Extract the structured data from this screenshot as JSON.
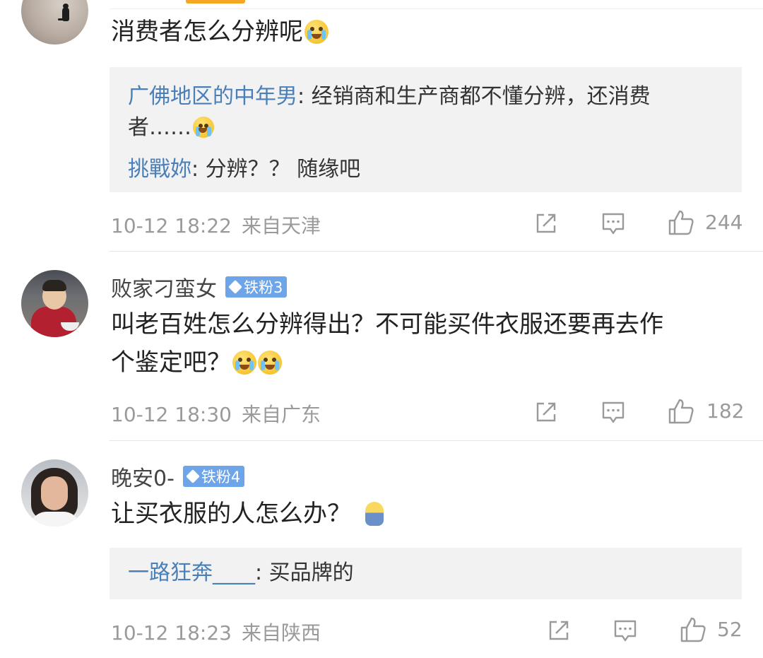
{
  "comments": [
    {
      "username": "",
      "badge": "",
      "text": "消费者怎么分辨呢",
      "emojis": [
        "crying-face"
      ],
      "replies": [
        {
          "name": "广佛地区的中年男",
          "text_line1": ": 经销商和生产商都不懂分辨，还消费",
          "text_line2": "者……"
        },
        {
          "name": "挑戰妳",
          "text": ": 分辨？？ 随缘吧"
        }
      ],
      "time": "10-12 18:22",
      "location": "来自天津",
      "likes": "244"
    },
    {
      "username": "败家刁蛮女",
      "badge": "铁粉3",
      "text_line1": "叫老百姓怎么分辨得出？不可能买件衣服还要再去作",
      "text_line2": "个鉴定吧？",
      "emojis": [
        "laughing-crying-face",
        "laughing-crying-face"
      ],
      "time": "10-12 18:30",
      "location": "来自广东",
      "likes": "182"
    },
    {
      "username": "晚安0-",
      "badge": "铁粉4",
      "text": "让买衣服的人怎么办？",
      "emojis": [
        "shy-face"
      ],
      "replies": [
        {
          "name": "一路狂奔____",
          "text": ": 买品牌的"
        }
      ],
      "time": "10-12 18:23",
      "location": "来自陕西",
      "likes": "52"
    }
  ],
  "icons": {
    "share": "share-icon",
    "comment": "comment-icon",
    "like": "like-icon"
  },
  "colors": {
    "accent": "#f5a623",
    "reply_name": "#4a7fb8",
    "badge": "#6ea5e8",
    "meta": "#9a9a9a",
    "reply_bg": "#f2f2f2"
  }
}
